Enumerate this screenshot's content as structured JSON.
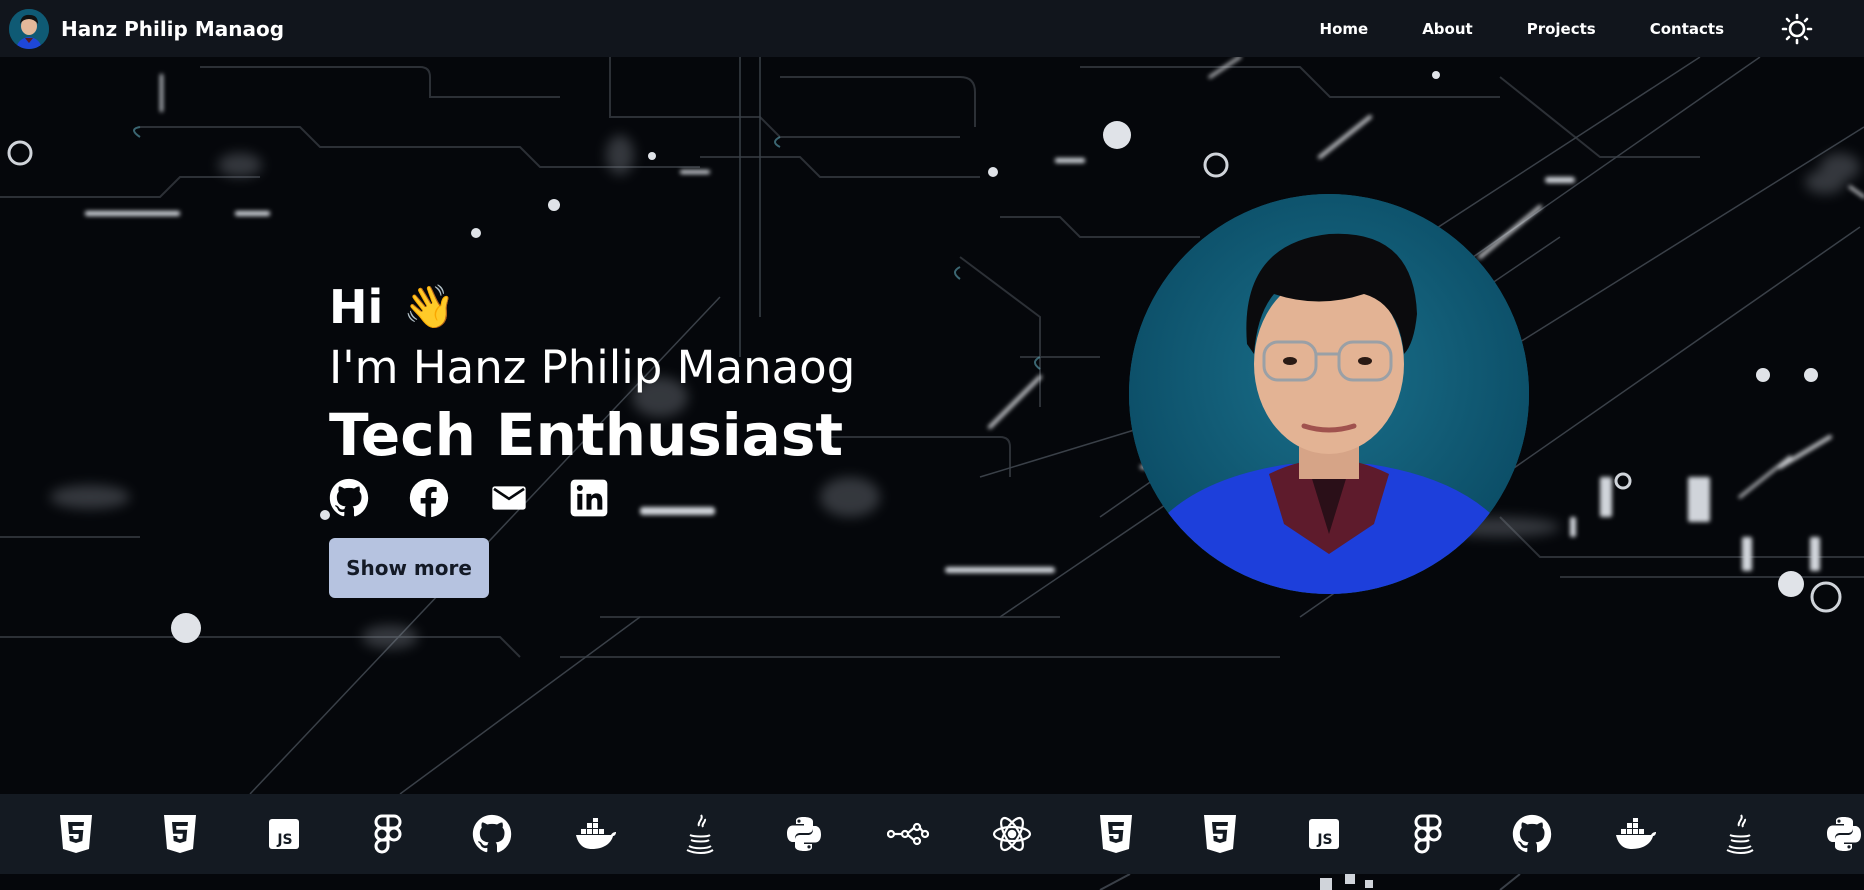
{
  "brand": {
    "name": "Hanz Philip Manaog"
  },
  "nav": {
    "links": [
      "Home",
      "About",
      "Projects",
      "Contacts"
    ],
    "theme_icon": "sun-icon"
  },
  "hero": {
    "greeting": "Hi",
    "wave_emoji": "👋",
    "intro": "I'm Hanz Philip Manaog",
    "role": "Tech Enthusiast",
    "socials": [
      "github-icon",
      "facebook-icon",
      "mail-icon",
      "linkedin-icon"
    ],
    "button_label": "Show more"
  },
  "tech_icons": [
    "html5-icon",
    "css3-icon",
    "javascript-icon",
    "figma-icon",
    "github-icon",
    "docker-icon",
    "java-icon",
    "python-icon",
    "git-graph-icon",
    "react-icon",
    "html5-icon",
    "css3-icon",
    "javascript-icon",
    "figma-icon",
    "github-icon",
    "docker-icon",
    "java-icon",
    "python-icon"
  ],
  "colors": {
    "navbar": "#11151c",
    "hero_bg": "#05070b",
    "button_bg": "#b6c3e0",
    "portrait_bg": "#0e5873",
    "strip_bg": "#141a22"
  }
}
